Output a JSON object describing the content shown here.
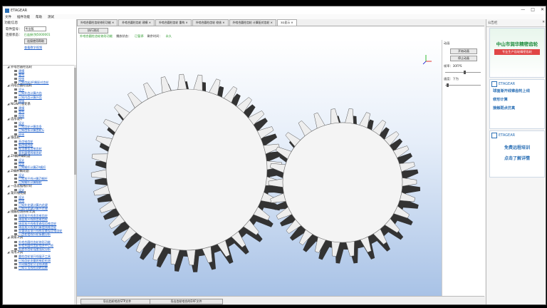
{
  "app": {
    "title": "ETAGEAR",
    "menu": [
      "文件",
      "插件功能",
      "帮助",
      "测试"
    ],
    "window_buttons": [
      "—",
      "□",
      "✕"
    ]
  },
  "left_panel": {
    "section_title": "功能信息",
    "license_label": "软件型号：",
    "license_value": "专业版",
    "connect_label": "连接状态：",
    "connect_value": "已连接(到5000001",
    "connect_button": "连接使用帮助",
    "help_link": "查看教学视频"
  },
  "tree": [
    {
      "group": "外啮合圆柱齿轮",
      "items": [
        "建模",
        "重构",
        "校核",
        "已知齿轮AR属配对齿轮"
      ]
    },
    {
      "group": "内啮合圆柱齿轮",
      "items": [
        "设计",
        "已知外齿计算内齿",
        "已知内齿计算外齿",
        "校核"
      ]
    },
    {
      "group": "NGW行星轮系",
      "items": [
        "建模",
        "重构",
        "校核"
      ]
    },
    {
      "group": "齿形设计",
      "items": [
        "设计",
        "已知齿轮计算齿条",
        "已知齿条计算齿轮G",
        "校核"
      ]
    },
    {
      "group": "锥齿轮",
      "items": [
        "直齿锥齿轮",
        "斜齿锥齿轮",
        "格里森弧齿锥齿轮",
        "奥利康摆线锥齿轮"
      ]
    },
    {
      "group": "ZA蜗杆蜗轮副",
      "items": [
        "设计",
        "校核",
        "已知蜗杆计算ZA蜗杆"
      ]
    },
    {
      "group": "ZI蜗杆蜗轮副",
      "items": [
        "设计",
        "已知渐开线计算ZI蜗杆",
        "已知蜗杆计算蜗轮"
      ]
    },
    {
      "group": "一齿差摆线针轮",
      "items": [
        "设计"
      ]
    },
    {
      "group": "渐开线花键",
      "items": [
        "设计",
        "校核",
        "已知外花键计算内花键",
        "已知内花键计算外花键"
      ]
    },
    {
      "group": "接触检测分析工具",
      "items": [
        "球面渐开线直齿锥齿轮",
        "球面渐开线斜齿锥齿轮",
        "球面渐开线格里森弧齿锥齿轮",
        "球面渐开线奥利康摆线锥齿轮",
        "双重球面渐开线格里森弧齿锥齿轮",
        "一齿差摆线针轮接触分析"
      ]
    },
    {
      "group": "高级工具",
      "items": [
        "外啮合圆柱齿轮修形功能",
        "外啮合圆柱齿轮啮合中心距",
        "外啮合齿轮强度强化分析"
      ]
    },
    {
      "group": "常用工具",
      "items": [
        "圆柱齿轮渐开线展开工具",
        "已知齿轮测量跨棒距检测",
        "不同模齿轮公法线测量",
        "已知公法线检测跨齿数"
      ]
    }
  ],
  "tabs": [
    {
      "label": "外啮合圆柱齿轮修形功能 ✕",
      "active": false
    },
    {
      "label": "外啮合圆柱齿轮 建模 ✕",
      "active": false
    },
    {
      "label": "外啮合圆柱齿轮 重构 ✕",
      "active": false
    },
    {
      "label": "外啮合圆柱齿轮 校核 ✕",
      "active": false
    },
    {
      "label": "外啮合圆柱齿轮 计算配对齿轮 ✕",
      "active": false
    },
    {
      "label": "3D显示 ✕",
      "active": true
    }
  ],
  "toolbar": {
    "run_button": "执行测试",
    "source_label": "外啮合圆柱齿轮修形功能",
    "status_label": "播放状态：",
    "status_value": "已暂停",
    "time_label": "剩余时间：",
    "time_value": "永久"
  },
  "viewport_side": {
    "animation_label": "动画",
    "start_button": "开始动画",
    "stop_button": "停止动画",
    "fps_label": "帧率：30FPS",
    "speed_label": "速度：下为",
    "fps_level": 0.55,
    "speed_level": 0.05
  },
  "bottom": {
    "export_step": "导出齿轮啮合STP文件",
    "export_dxf": "导出齿轮啮合的DXF文件"
  },
  "right_panel": {
    "header": "公告栏",
    "close": "✕",
    "ad1": {
      "title": "中山市润华精密齿轮",
      "subtitle": "专业生产齿轮精密齿轮",
      "brand_color": "#1a8a3a"
    },
    "ad2": {
      "brand": "ETAGEAR",
      "lines": [
        "球面渐开线锥齿轮上线",
        "修形计算",
        "接触斑点仿真"
      ]
    },
    "ad3": {
      "brand": "ETAGEAR",
      "lines": [
        "免费远程培训",
        "点击了解详情"
      ]
    }
  },
  "colors": {
    "gear_face": "#eeeeee",
    "gear_side": "#333333",
    "link": "#1a5cc8",
    "accent": "#2a6fb5"
  }
}
